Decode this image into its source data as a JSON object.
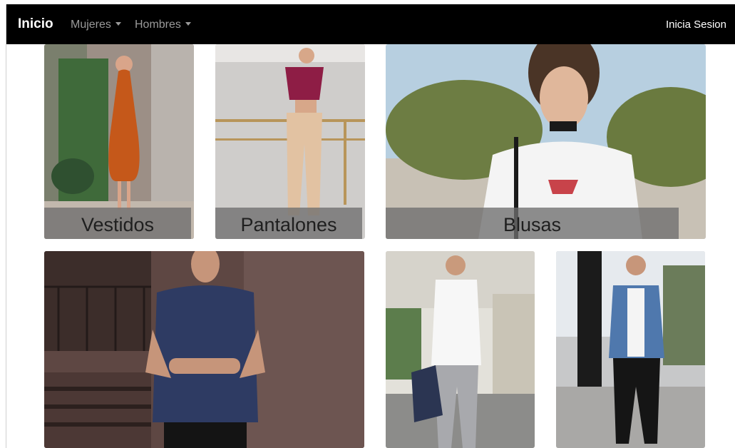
{
  "navbar": {
    "brand": "Inicio",
    "menu": [
      {
        "label": "Mujeres"
      },
      {
        "label": "Hombres"
      }
    ],
    "login": "Inicia Sesion"
  },
  "categories": [
    {
      "label": "Vestidos"
    },
    {
      "label": "Pantalones"
    },
    {
      "label": "Blusas"
    }
  ],
  "colors": {
    "navbar_bg": "#000000",
    "label_overlay": "#6e6e6e"
  }
}
